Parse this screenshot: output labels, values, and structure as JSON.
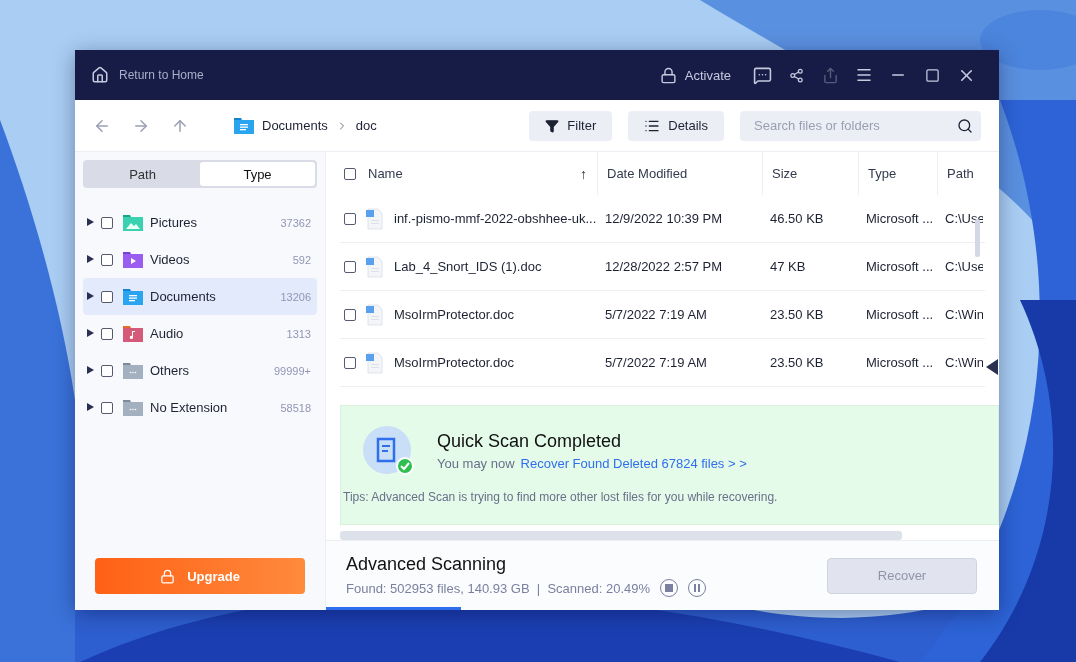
{
  "title_bar": {
    "home_label": "Return to Home",
    "activate_label": "Activate"
  },
  "toolbar": {
    "breadcrumb": [
      "Documents",
      "doc"
    ],
    "filter_label": "Filter",
    "details_label": "Details",
    "search": {
      "placeholder": "Search files or folders"
    }
  },
  "sidebar": {
    "tabs": [
      {
        "label": "Path",
        "selected": false
      },
      {
        "label": "Type",
        "selected": true
      }
    ],
    "items": [
      {
        "label": "Pictures",
        "count": "37362",
        "kind": "pictures",
        "selected": false,
        "checked": false
      },
      {
        "label": "Videos",
        "count": "592",
        "kind": "videos",
        "selected": false,
        "checked": false
      },
      {
        "label": "Documents",
        "count": "13206",
        "kind": "documents",
        "selected": true,
        "checked": false
      },
      {
        "label": "Audio",
        "count": "1313",
        "kind": "audio",
        "selected": false,
        "checked": false
      },
      {
        "label": "Others",
        "count": "99999+",
        "kind": "others",
        "selected": false,
        "checked": false
      },
      {
        "label": "No Extension",
        "count": "58518",
        "kind": "others",
        "selected": false,
        "checked": false
      }
    ],
    "upgrade_label": "Upgrade"
  },
  "table": {
    "select_all_checked": false,
    "columns": [
      "Name",
      "Date Modified",
      "Size",
      "Type",
      "Path"
    ],
    "sort_arrow": "↑",
    "rows": [
      {
        "name": "inf.-pismo-mmf-2022-obshhee-uk...",
        "date": "12/9/2022 10:39 PM",
        "size": "46.50 KB",
        "type": "Microsoft ...",
        "path": "C:\\Use",
        "checked": false
      },
      {
        "name": "Lab_4_Snort_IDS (1).doc",
        "date": "12/28/2022 2:57 PM",
        "size": "47 KB",
        "type": "Microsoft ...",
        "path": "C:\\Use",
        "checked": false
      },
      {
        "name": "MsoIrmProtector.doc",
        "date": "5/7/2022 7:19 AM",
        "size": "23.50 KB",
        "type": "Microsoft ...",
        "path": "C:\\Win",
        "checked": false
      },
      {
        "name": "MsoIrmProtector.doc",
        "date": "5/7/2022 7:19 AM",
        "size": "23.50 KB",
        "type": "Microsoft ...",
        "path": "C:\\Win",
        "checked": false
      }
    ]
  },
  "notice": {
    "title": "Quick Scan Completed",
    "text": "You may now",
    "link": "Recover Found Deleted 67824 files > >",
    "tips": "Tips: Advanced Scan is trying to find more other lost files for you while recovering."
  },
  "footer": {
    "title": "Advanced Scanning",
    "status": "Found: 502953 files, 140.93 GB  |  Scanned: 20.49%",
    "level": 0.2,
    "recover_label": "Recover",
    "recover_disabled": true
  }
}
